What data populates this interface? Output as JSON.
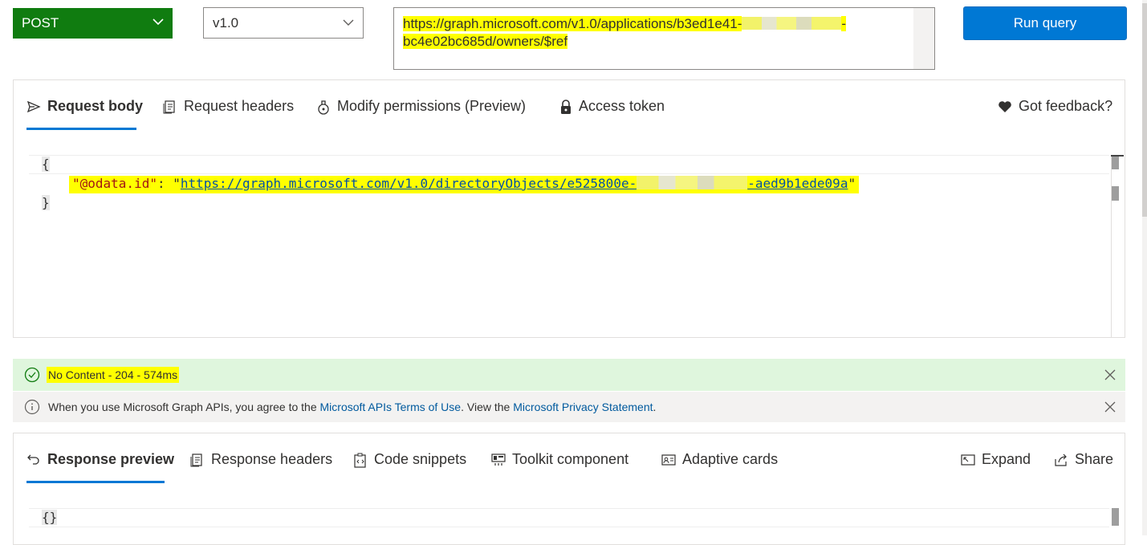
{
  "top_bar": {
    "method": "POST",
    "version": "v1.0",
    "url_line1_prefix": "https://graph.microsoft.com/v1.0/applications/b3ed1e41-",
    "url_line1_suffix": "-",
    "url_line2": "bc4e02bc685d/owners/$ref",
    "run_button": "Run query"
  },
  "request_tabs": {
    "request_body": "Request body",
    "request_headers": "Request headers",
    "modify_permissions": "Modify permissions (Preview)",
    "access_token": "Access token",
    "feedback": "Got feedback?"
  },
  "request_body": {
    "open_brace": "{",
    "key": "\"@odata.id\"",
    "colon": ": ",
    "value_quote_open": "\"",
    "value_prefix": "https://graph.microsoft.com/v1.0/directoryObjects/e525800e-",
    "value_suffix": "-aed9b1ede09a",
    "value_quote_close": "\"",
    "close_brace": "}"
  },
  "status": {
    "message": "No Content - 204 - 574ms"
  },
  "info_bar": {
    "text_before": "When you use Microsoft Graph APIs, you agree to the ",
    "terms_link": "Microsoft APIs Terms of Use",
    "text_middle": ". View the ",
    "privacy_link": "Microsoft Privacy Statement",
    "text_after": "."
  },
  "response_tabs": {
    "response_preview": "Response preview",
    "response_headers": "Response headers",
    "code_snippets": "Code snippets",
    "toolkit_component": "Toolkit component",
    "adaptive_cards": "Adaptive cards",
    "expand": "Expand",
    "share": "Share"
  },
  "response_body": {
    "content": "{}"
  },
  "colors": {
    "method_green": "#107c10",
    "accent_blue": "#0078d4",
    "success_bg": "#dff6dd",
    "highlight": "#ffff00"
  }
}
